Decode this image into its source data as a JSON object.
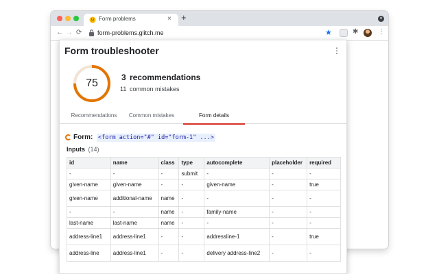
{
  "browser": {
    "tab_title": "Form problems",
    "tab_close": "×",
    "new_tab": "+",
    "url": "form-problems.glitch.me",
    "nav": {
      "back": "←",
      "forward": "→",
      "reload": "⟳"
    },
    "star": "★",
    "puzzle": "✱",
    "menu": "⋮"
  },
  "popup": {
    "title": "Form troubleshooter",
    "menu": "⋮",
    "score": "75",
    "score_fraction": 0.75,
    "colors": {
      "gauge": "#e37400",
      "gauge_track": "#f3e3d3",
      "active_tab": "#d93025"
    },
    "recommendations_count": "3",
    "recommendations_label": "recommendations",
    "mistakes_count": "11",
    "mistakes_label": "common mistakes",
    "tabs": [
      {
        "label": "Recommendations"
      },
      {
        "label": "Common mistakes"
      },
      {
        "label": "Form details"
      }
    ],
    "active_tab": "Form details",
    "form_label": "Form:",
    "form_code": "<form action=\"#\" id=\"form-1\" ...>",
    "inputs_label": "Inputs",
    "inputs_count": "(14)",
    "table": {
      "headers": [
        "id",
        "name",
        "class",
        "type",
        "autocomplete",
        "placeholder",
        "required"
      ],
      "rows": [
        [
          "-",
          "-",
          "-",
          "submit",
          "-",
          "-",
          "-"
        ],
        [
          "given-name",
          "given-name",
          "-",
          "-",
          "given-name",
          "-",
          "true"
        ],
        [
          "given-name",
          "additional-name",
          "name",
          "-",
          "-",
          "-",
          "-"
        ],
        [
          "-",
          "-",
          "name",
          "-",
          "family-name",
          "-",
          "-"
        ],
        [
          "last-name",
          "last-name",
          "name",
          "-",
          "-",
          "-",
          "-"
        ],
        [
          "address-line1",
          "address-line1",
          "-",
          "-",
          "addressline-1",
          "-",
          "true"
        ],
        [
          "address-line",
          "address-line1",
          "-",
          "-",
          "delivery address-line2",
          "-",
          "-"
        ]
      ]
    }
  }
}
